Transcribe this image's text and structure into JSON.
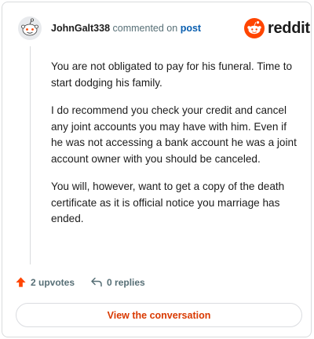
{
  "header": {
    "username": "JohnGalt338",
    "action_text": "commented on",
    "post_link": "post"
  },
  "brand": {
    "name": "reddit",
    "color": "#ff4500"
  },
  "comment": {
    "paragraphs": [
      "You are not obligated to pay for his funeral. Time to start dodging his family.",
      "I do recommend you check your credit and cancel any joint accounts you may have with him. Even if he was not accessing a bank account he was a joint account owner with you should be canceled.",
      "You will, however, want to get a copy of the death certificate as it is official notice you marriage has ended."
    ]
  },
  "actions": {
    "upvotes": "2 upvotes",
    "replies": "0 replies"
  },
  "cta": {
    "label": "View the conversation",
    "color": "#d93900"
  }
}
